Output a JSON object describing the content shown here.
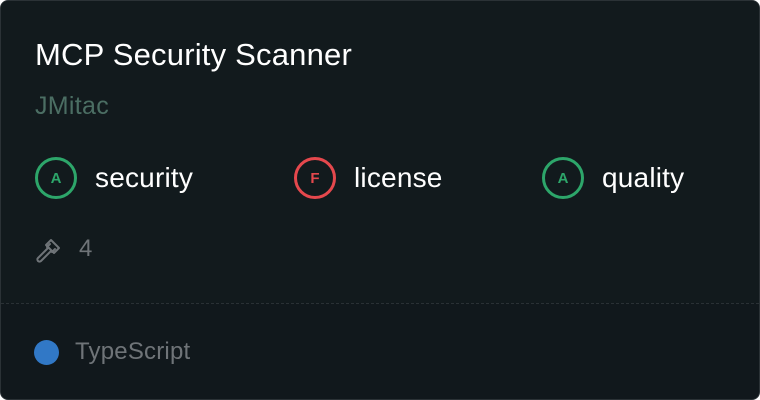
{
  "card": {
    "title": "MCP Security Scanner",
    "author": "JMitac",
    "grades": [
      {
        "grade": "A",
        "label": "security",
        "color": "#2da66a"
      },
      {
        "grade": "F",
        "label": "license",
        "color": "#e5484d"
      },
      {
        "grade": "A",
        "label": "quality",
        "color": "#2da66a"
      }
    ],
    "tools": {
      "icon": "hammer-icon",
      "count": "4"
    },
    "language": {
      "name": "TypeScript",
      "color": "#3178c6"
    }
  }
}
